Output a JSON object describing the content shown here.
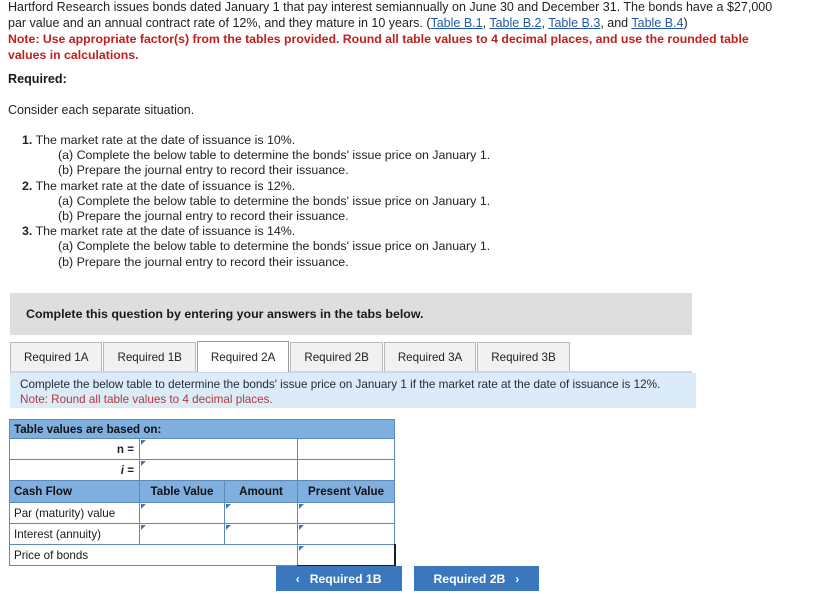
{
  "statement": {
    "line1": "Hartford Research issues bonds dated January 1 that pay interest semiannually on June 30 and December 31. The bonds have a",
    "line2_pre": "$27,000 par value and an annual contract rate of 12%, and they mature in 10 years. (",
    "links": [
      "Table B.1",
      "Table B.2",
      "Table B.3",
      "Table B.4"
    ],
    "link_sep1": ", ",
    "link_sep2": ", ",
    "link_sep3": ", and ",
    "line2_post": ")",
    "note": "Note: Use appropriate factor(s) from the tables provided. Round all table values to 4 decimal places, and use the rounded table values in calculations."
  },
  "required_heading": "Required:",
  "consider": "Consider each separate situation.",
  "situations": [
    {
      "num": "1.",
      "main": "The market rate at the date of issuance is 10%.",
      "sub_a": "(a) Complete the below table to determine the bonds' issue price on January 1.",
      "sub_b": "(b) Prepare the journal entry to record their issuance."
    },
    {
      "num": "2.",
      "main": "The market rate at the date of issuance is 12%.",
      "sub_a": "(a) Complete the below table to determine the bonds' issue price on January 1.",
      "sub_b": "(b) Prepare the journal entry to record their issuance."
    },
    {
      "num": "3.",
      "main": "The market rate at the date of issuance is 14%.",
      "sub_a": "(a) Complete the below table to determine the bonds' issue price on January 1.",
      "sub_b": "(b) Prepare the journal entry to record their issuance."
    }
  ],
  "gray_banner": "Complete this question by entering your answers in the tabs below.",
  "tabs": [
    {
      "label": "Required 1A",
      "active": false
    },
    {
      "label": "Required 1B",
      "active": false
    },
    {
      "label": "Required 2A",
      "active": true
    },
    {
      "label": "Required 2B",
      "active": false
    },
    {
      "label": "Required 3A",
      "active": false
    },
    {
      "label": "Required 3B",
      "active": false
    }
  ],
  "instruction": {
    "line1": "Complete the below table to determine the bonds' issue price on January 1 if the market rate at the date of issuance is 12%.",
    "line2": "Note: Round all table values to 4 decimal places."
  },
  "answer_table": {
    "title_row": "Table values are based on:",
    "n_label": "n =",
    "i_label_italic": "i",
    "i_label_rest": " =",
    "n_value": "",
    "i_value": "",
    "columns": [
      "Cash Flow",
      "Table Value",
      "Amount",
      "Present Value"
    ],
    "rows": [
      {
        "label": "Par (maturity) value",
        "table_value": "",
        "amount": "",
        "present_value": ""
      },
      {
        "label": "Interest (annuity)",
        "table_value": "",
        "amount": "",
        "present_value": ""
      }
    ],
    "total_row": {
      "label": "Price of bonds",
      "value": ""
    }
  },
  "nav": {
    "prev_chevron": "‹",
    "prev_label": "Required 1B",
    "next_label": "Required 2B",
    "next_chevron": "›"
  },
  "colors": {
    "header_blue": "#7fafdf",
    "border_blue": "#5e89b8",
    "instruction_bg": "#dcebf8",
    "banner_gray": "#dedede",
    "button_blue": "#3a77bd",
    "note_red": "#c0201c",
    "link_blue": "#2159a8"
  }
}
